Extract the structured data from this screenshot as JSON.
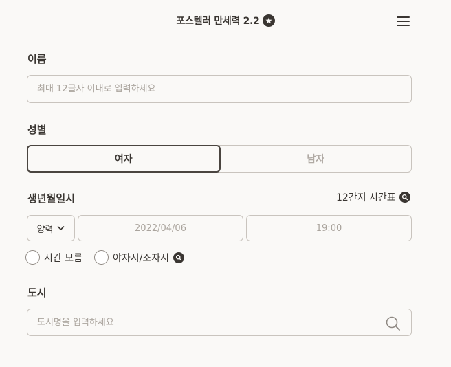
{
  "header": {
    "title": "포스텔러 만세력 2.2",
    "badge_icon": "star-icon",
    "menu_icon": "hamburger-menu-icon"
  },
  "name_section": {
    "label": "이름",
    "placeholder": "최대 12글자 이내로 입력하세요",
    "value": ""
  },
  "gender_section": {
    "label": "성별",
    "options": [
      {
        "label": "여자",
        "selected": true
      },
      {
        "label": "남자",
        "selected": false
      }
    ]
  },
  "birth_section": {
    "label": "생년월일시",
    "table_link": "12간지 시간표",
    "table_link_icon": "search-icon",
    "calendar_type": "양력",
    "calendar_icon": "chevron-down-icon",
    "date_placeholder": "2022/04/06",
    "time_placeholder": "19:00",
    "unknown_time_label": "시간 모름",
    "unknown_time_checked": false,
    "night_hour_label": "야자시/조자시",
    "night_hour_checked": false,
    "night_hour_icon": "search-icon"
  },
  "city_section": {
    "label": "도시",
    "placeholder": "도시명을 입력하세요",
    "search_icon": "search-icon"
  },
  "colors": {
    "background": "#faf9f7",
    "text": "#3a3632",
    "border": "#c9c4be",
    "muted": "#b0aaa4"
  }
}
